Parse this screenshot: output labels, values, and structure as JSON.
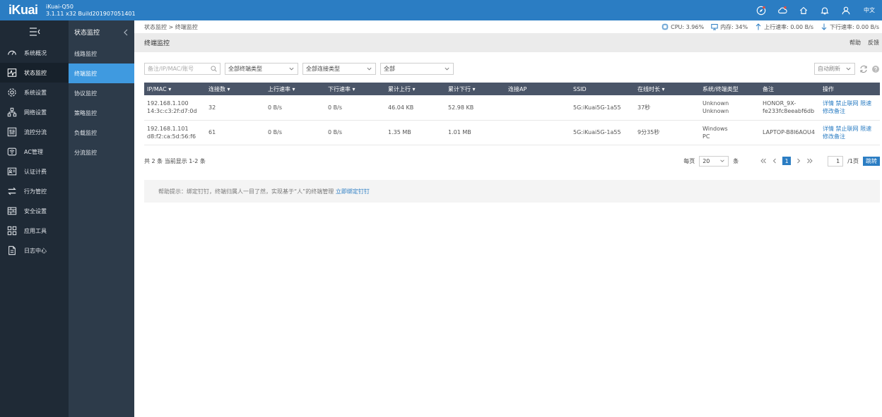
{
  "brand": {
    "logo": "iKuai",
    "model": "iKuai-Q50",
    "build": "3.1.11 x32 Build201907051401"
  },
  "topbar": {
    "lang": "中文"
  },
  "sidebar": {
    "items": [
      {
        "label": "系统概况",
        "icon": "dashboard-icon"
      },
      {
        "label": "状态监控",
        "icon": "pulse-icon"
      },
      {
        "label": "系统设置",
        "icon": "gear-icon"
      },
      {
        "label": "网络设置",
        "icon": "network-icon"
      },
      {
        "label": "流控分流",
        "icon": "sliders-icon"
      },
      {
        "label": "AC管理",
        "icon": "wifi-icon"
      },
      {
        "label": "认证计费",
        "icon": "id-card-icon"
      },
      {
        "label": "行为管控",
        "icon": "arrows-icon"
      },
      {
        "label": "安全设置",
        "icon": "firewall-icon"
      },
      {
        "label": "应用工具",
        "icon": "apps-icon"
      },
      {
        "label": "日志中心",
        "icon": "document-icon"
      }
    ]
  },
  "subside": {
    "title": "状态监控",
    "items": [
      "线路监控",
      "终端监控",
      "协议监控",
      "策略监控",
      "负载监控",
      "分流监控"
    ]
  },
  "crumb": "状态监控 > 终端监控",
  "stats": {
    "cpu": "CPU: 3.96%",
    "mem": "内存: 34%",
    "up": "上行速率: 0.00 B/s",
    "down": "下行速率: 0.00 B/s"
  },
  "page": {
    "title": "终端监控",
    "help": "帮助",
    "feedback": "反馈"
  },
  "filters": {
    "search_placeholder": "备注/IP/MAC/账号",
    "type": "全部终端类型",
    "conn": "全部连接类型",
    "all": "全部",
    "auto": "自动刷新"
  },
  "table": {
    "headers": [
      "IP/MAC",
      "连接数",
      "上行速率",
      "下行速率",
      "累计上行",
      "累计下行",
      "连接AP",
      "SSID",
      "在线时长",
      "系统/终端类型",
      "备注",
      "操作"
    ],
    "rows": [
      {
        "ip": "192.168.1.100",
        "mac": "14:3c:c3:2f:d7:0d",
        "conn": "32",
        "up": "0 B/s",
        "down": "0 B/s",
        "total_up": "46.04 KB",
        "total_down": "52.98 KB",
        "ap": "",
        "ssid": "5G:iKuai5G-1a55",
        "time": "37秒",
        "sys1": "Unknown",
        "sys2": "Unknown",
        "note1": "HONOR_9X-",
        "note2": "fe233fc8eeabf6db"
      },
      {
        "ip": "192.168.1.101",
        "mac": "d8:f2:ca:5d:56:f6",
        "conn": "61",
        "up": "0 B/s",
        "down": "0 B/s",
        "total_up": "1.35 MB",
        "total_down": "1.01 MB",
        "ap": "",
        "ssid": "5G:iKuai5G-1a55",
        "time": "9分35秒",
        "sys1": "Windows",
        "sys2": "PC",
        "note1": "LAPTOP-B8I6AOU4",
        "note2": ""
      }
    ],
    "actions": {
      "detail": "详情",
      "block": "禁止联网",
      "limit": "限速",
      "edit": "修改备注"
    }
  },
  "footer": {
    "summary": "共 2 条 当前显示 1-2 条",
    "per_page": "每页",
    "per_page_val": "20",
    "unit": "条",
    "page": "1",
    "goto_val": "1",
    "total_pages": "/1页",
    "jump": "跳转"
  },
  "help": {
    "text": "帮助提示：绑定钉钉，终端归属人一目了然，实现基于“人”的终端管理",
    "link": "立即绑定钉钉"
  }
}
